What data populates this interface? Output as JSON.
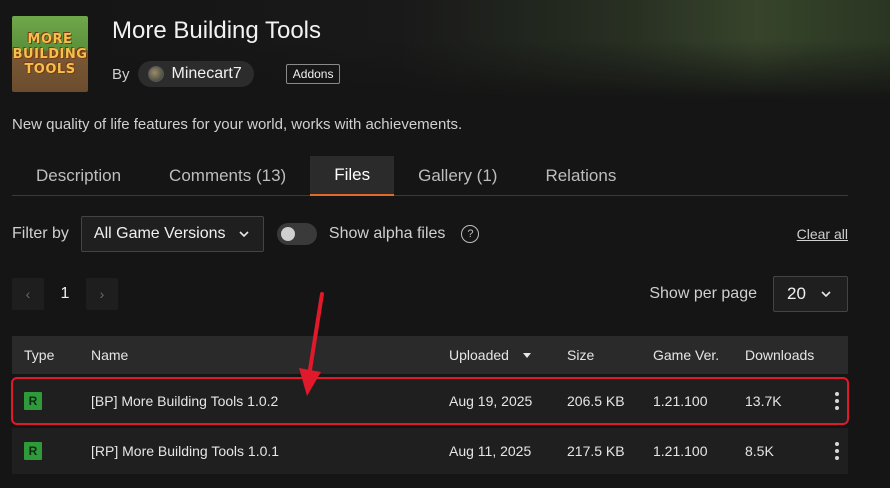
{
  "project": {
    "title": "More Building Tools",
    "by_label": "By",
    "author": "Minecart7",
    "category_tag": "Addons",
    "summary": "New quality of life features for your world, works with achievements.",
    "logo_lines": [
      "MORE",
      "BUILDING",
      "TOOLS"
    ]
  },
  "tabs": [
    {
      "label": "Description",
      "active": false
    },
    {
      "label": "Comments (13)",
      "active": false
    },
    {
      "label": "Files",
      "active": true
    },
    {
      "label": "Gallery (1)",
      "active": false
    },
    {
      "label": "Relations",
      "active": false
    }
  ],
  "filters": {
    "filter_by_label": "Filter by",
    "game_versions_value": "All Game Versions",
    "show_alpha_label": "Show alpha files",
    "show_alpha_on": false,
    "help_symbol": "?",
    "clear_all_label": "Clear all"
  },
  "pagination": {
    "current_page": "1",
    "prev_symbol": "‹",
    "next_symbol": "›",
    "per_page_label": "Show per page",
    "per_page_value": "20"
  },
  "table": {
    "headers": {
      "type": "Type",
      "name": "Name",
      "uploaded": "Uploaded",
      "size": "Size",
      "game_ver": "Game Ver.",
      "downloads": "Downloads"
    },
    "rows": [
      {
        "type": "R",
        "name": "[BP] More Building Tools 1.0.2",
        "uploaded": "Aug 19, 2025",
        "size": "206.5 KB",
        "game_ver": "1.21.100",
        "downloads": "13.7K",
        "highlighted": true
      },
      {
        "type": "R",
        "name": "[RP] More Building Tools 1.0.1",
        "uploaded": "Aug 11, 2025",
        "size": "217.5 KB",
        "game_ver": "1.21.100",
        "downloads": "8.5K",
        "highlighted": false
      }
    ]
  },
  "colors": {
    "accent": "#e06a2a",
    "release_badge": "#2e9a3a",
    "highlight": "#e0192b"
  }
}
